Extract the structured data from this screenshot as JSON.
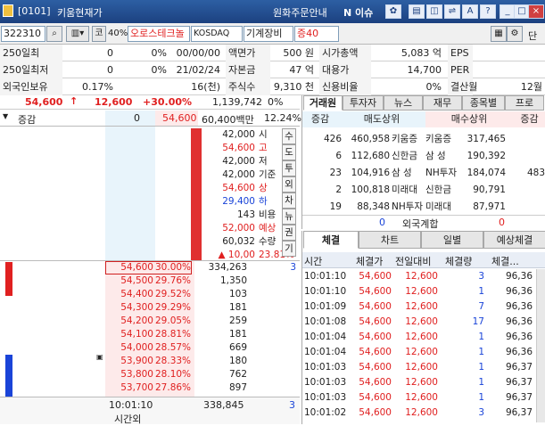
{
  "window": {
    "code": "[0101]",
    "title": "키움현재가",
    "notice": "원화주문안내",
    "ni_label": "N 이슈"
  },
  "toolbar": {
    "code": "322310",
    "ratio": "40%",
    "badge": "코",
    "stock_name": "오로스테크놀",
    "market": "KOSDAQ",
    "sector": "기계장비",
    "margin": "증40",
    "right_label": "단"
  },
  "info": {
    "rows": [
      {
        "l1": "250일최",
        "v1": "0",
        "p1": "0%",
        "d1": "00/00/00",
        "l2": "액면가",
        "v2": "500 원",
        "l3": "시가총액",
        "v3": "5,083 억",
        "l4": "EPS",
        "v4": ""
      },
      {
        "l1": "250일최저",
        "v1": "0",
        "p1": "0%",
        "d1": "21/02/24",
        "l2": "자본금",
        "v2": "47 억",
        "l3": "대용가",
        "v3": "14,700",
        "l4": "PER",
        "v4": ""
      },
      {
        "l1": "외국인보유",
        "v1": "0.17%",
        "p1": "",
        "d1": "16(천)",
        "l2": "주식수",
        "v2": "9,310 천",
        "l3": "신용비율",
        "v3": "0%",
        "l4": "결산월",
        "v4": "12월"
      }
    ]
  },
  "price": {
    "current": "54,600",
    "arrow": "↑",
    "change": "12,600",
    "rate": "+30.00%",
    "volume": "1,139,742",
    "vol_rate": "0%"
  },
  "inc": {
    "label": "증감",
    "zero": "0",
    "price": "54,600",
    "amount": "60,400백만",
    "rate": "12.24%"
  },
  "summary": [
    {
      "v": "42,000",
      "k": "시",
      "cls": ""
    },
    {
      "v": "54,600",
      "k": "고",
      "cls": "red"
    },
    {
      "v": "42,000",
      "k": "저",
      "cls": ""
    },
    {
      "v": "42,000",
      "k": "기준",
      "cls": ""
    },
    {
      "v": "54,600",
      "k": "상",
      "cls": "red"
    },
    {
      "v": "29,400",
      "k": "하",
      "cls": "blue"
    },
    {
      "v": "143",
      "k": "비용",
      "cls": ""
    },
    {
      "v": "52,000",
      "k": "예상",
      "cls": "red"
    },
    {
      "v": "60,032",
      "k": "수량",
      "cls": ""
    },
    {
      "v": "▲ 10,00",
      "k": "23.81%",
      "cls": "red"
    }
  ],
  "side_buttons": [
    "수",
    "도",
    "투",
    "외",
    "차",
    "뉴",
    "권",
    "기"
  ],
  "bids": [
    {
      "p": "54,600",
      "r": "30.00%",
      "q": "334,263",
      "x": "3"
    },
    {
      "p": "54,500",
      "r": "29.76%",
      "q": "1,350",
      "x": ""
    },
    {
      "p": "54,400",
      "r": "29.52%",
      "q": "103",
      "x": ""
    },
    {
      "p": "54,300",
      "r": "29.29%",
      "q": "181",
      "x": ""
    },
    {
      "p": "54,200",
      "r": "29.05%",
      "q": "259",
      "x": ""
    },
    {
      "p": "54,100",
      "r": "28.81%",
      "q": "181",
      "x": ""
    },
    {
      "p": "54,000",
      "r": "28.57%",
      "q": "669",
      "x": ""
    },
    {
      "p": "53,900",
      "r": "28.33%",
      "q": "180",
      "x": ""
    },
    {
      "p": "53,800",
      "r": "28.10%",
      "q": "762",
      "x": ""
    },
    {
      "p": "53,700",
      "r": "27.86%",
      "q": "897",
      "x": ""
    }
  ],
  "ob_footer": {
    "time": "10:01:10",
    "after": "시간외",
    "total": "338,845",
    "x": "3"
  },
  "broker_tabs": [
    "거래원",
    "투자자",
    "뉴스",
    "재무",
    "종목별",
    "프로"
  ],
  "broker_head": {
    "inc": "증감",
    "sell": "매도상위",
    "buy": "매수상위",
    "inc2": "증감"
  },
  "brokers": [
    {
      "si": "426",
      "sq": "460,958",
      "sn": "키움증",
      "bn": "키움증",
      "bq": "317,465",
      "bi": ""
    },
    {
      "si": "6",
      "sq": "112,680",
      "sn": "신한금",
      "bn": "삼 성",
      "bq": "190,392",
      "bi": ""
    },
    {
      "si": "23",
      "sq": "104,916",
      "sn": "삼 성",
      "bn": "NH투자",
      "bq": "184,074",
      "bi": "483"
    },
    {
      "si": "2",
      "sq": "100,818",
      "sn": "미래대",
      "bn": "신한금",
      "bq": "90,791",
      "bi": ""
    },
    {
      "si": "19",
      "sq": "88,348",
      "sn": "NH투자",
      "bn": "미래대",
      "bq": "87,971",
      "bi": ""
    }
  ],
  "foreign": {
    "l": "0",
    "label": "외국계합",
    "r": "0"
  },
  "trade_tabs": [
    "체결",
    "차트",
    "일별",
    "예상체결"
  ],
  "trade_head": [
    "시간",
    "체결가",
    "전일대비",
    "체결량",
    "체결..."
  ],
  "trades": [
    {
      "t": "10:01:10",
      "p": "54,600",
      "c": "12,600",
      "q": "3",
      "s": "96,36"
    },
    {
      "t": "10:01:10",
      "p": "54,600",
      "c": "12,600",
      "q": "1",
      "s": "96,36"
    },
    {
      "t": "10:01:09",
      "p": "54,600",
      "c": "12,600",
      "q": "7",
      "s": "96,36"
    },
    {
      "t": "10:01:08",
      "p": "54,600",
      "c": "12,600",
      "q": "17",
      "s": "96,36"
    },
    {
      "t": "10:01:04",
      "p": "54,600",
      "c": "12,600",
      "q": "1",
      "s": "96,36"
    },
    {
      "t": "10:01:04",
      "p": "54,600",
      "c": "12,600",
      "q": "1",
      "s": "96,36"
    },
    {
      "t": "10:01:03",
      "p": "54,600",
      "c": "12,600",
      "q": "1",
      "s": "96,37"
    },
    {
      "t": "10:01:03",
      "p": "54,600",
      "c": "12,600",
      "q": "1",
      "s": "96,37"
    },
    {
      "t": "10:01:03",
      "p": "54,600",
      "c": "12,600",
      "q": "1",
      "s": "96,37"
    },
    {
      "t": "10:01:02",
      "p": "54,600",
      "c": "12,600",
      "q": "3",
      "s": "96,37"
    }
  ]
}
